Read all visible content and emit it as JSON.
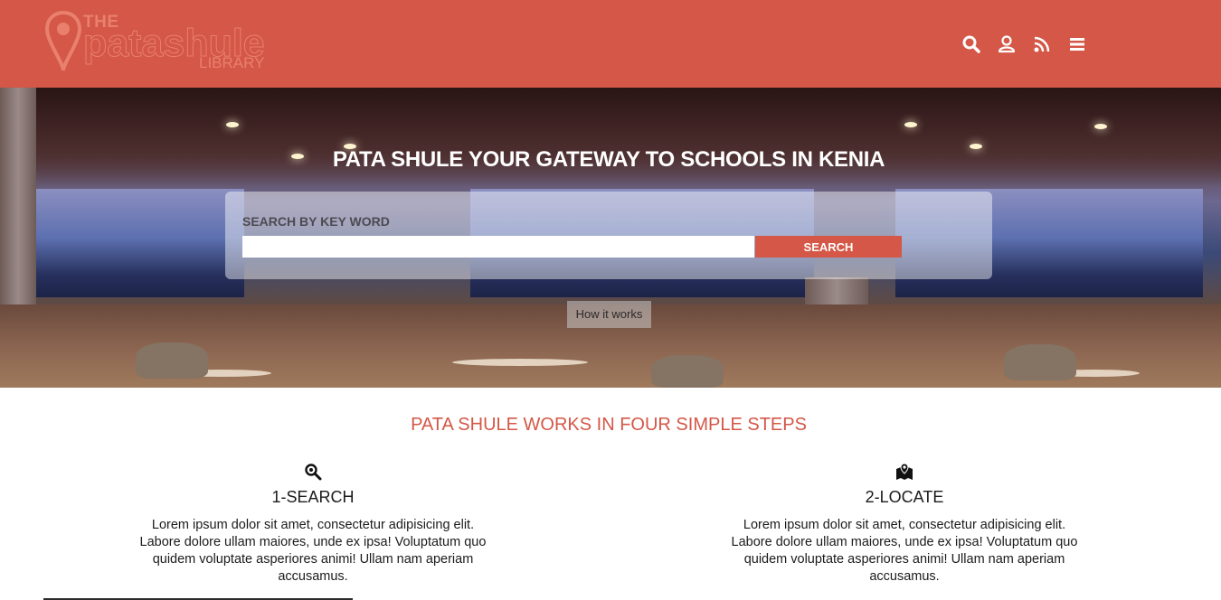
{
  "header": {
    "logo": {
      "the": "THE",
      "name": "patashule",
      "library": "LIBRARY"
    },
    "icons": [
      "search-icon",
      "user-icon",
      "rss-icon",
      "menu-icon"
    ],
    "color": "#d45747"
  },
  "hero": {
    "title": "PATA SHULE YOUR GATEWAY TO SCHOOLS IN KENIA",
    "search": {
      "label": "SEARCH BY KEY WORD",
      "value": "",
      "placeholder": "",
      "button_label": "SEARCH"
    },
    "how_it_works_label": "How it works"
  },
  "steps": {
    "title": "PATA SHULE WORKS IN FOUR SIMPLE STEPS",
    "items": [
      {
        "icon": "magnifier-search-icon",
        "title": "1-SEARCH",
        "text": "Lorem ipsum dolor sit amet, consectetur adipisicing elit. Labore dolore ullam maiores, unde ex ipsa! Voluptatum quo quidem voluptate asperiores animi! Ullam nam aperiam accusamus."
      },
      {
        "icon": "map-pin-icon",
        "title": "2-LOCATE",
        "text": "Lorem ipsum dolor sit amet, consectetur adipisicing elit. Labore dolore ullam maiores, unde ex ipsa! Voluptatum quo quidem voluptate asperiores animi! Ullam nam aperiam accusamus."
      }
    ]
  },
  "colors": {
    "accent": "#d45747",
    "logo": "#e9806e",
    "text": "#1b1b1b"
  }
}
